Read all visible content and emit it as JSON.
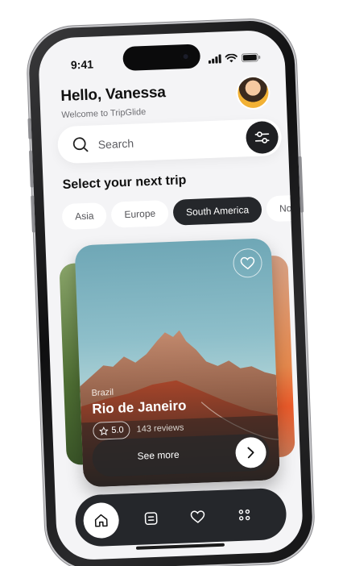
{
  "status_bar": {
    "time": "9:41"
  },
  "header": {
    "greeting": "Hello, Vanessa",
    "subtitle": "Welcome to TripGlide"
  },
  "search": {
    "placeholder": "Search"
  },
  "section": {
    "title": "Select your next trip"
  },
  "categories": [
    {
      "label": "Asia",
      "active": false
    },
    {
      "label": "Europe",
      "active": false
    },
    {
      "label": "South America",
      "active": true
    },
    {
      "label": "No",
      "active": false
    }
  ],
  "featured_card": {
    "country": "Brazil",
    "city": "Rio de Janeiro",
    "rating": "5.0",
    "reviews": "143 reviews",
    "cta": "See more"
  },
  "bottom_nav": [
    {
      "icon": "home-icon",
      "active": true
    },
    {
      "icon": "list-icon",
      "active": false
    },
    {
      "icon": "heart-icon",
      "active": false
    },
    {
      "icon": "grid-icon",
      "active": false
    }
  ],
  "colors": {
    "accent_dark": "#25272b",
    "background": "#f4f4f6",
    "chip_bg": "#ffffff"
  }
}
